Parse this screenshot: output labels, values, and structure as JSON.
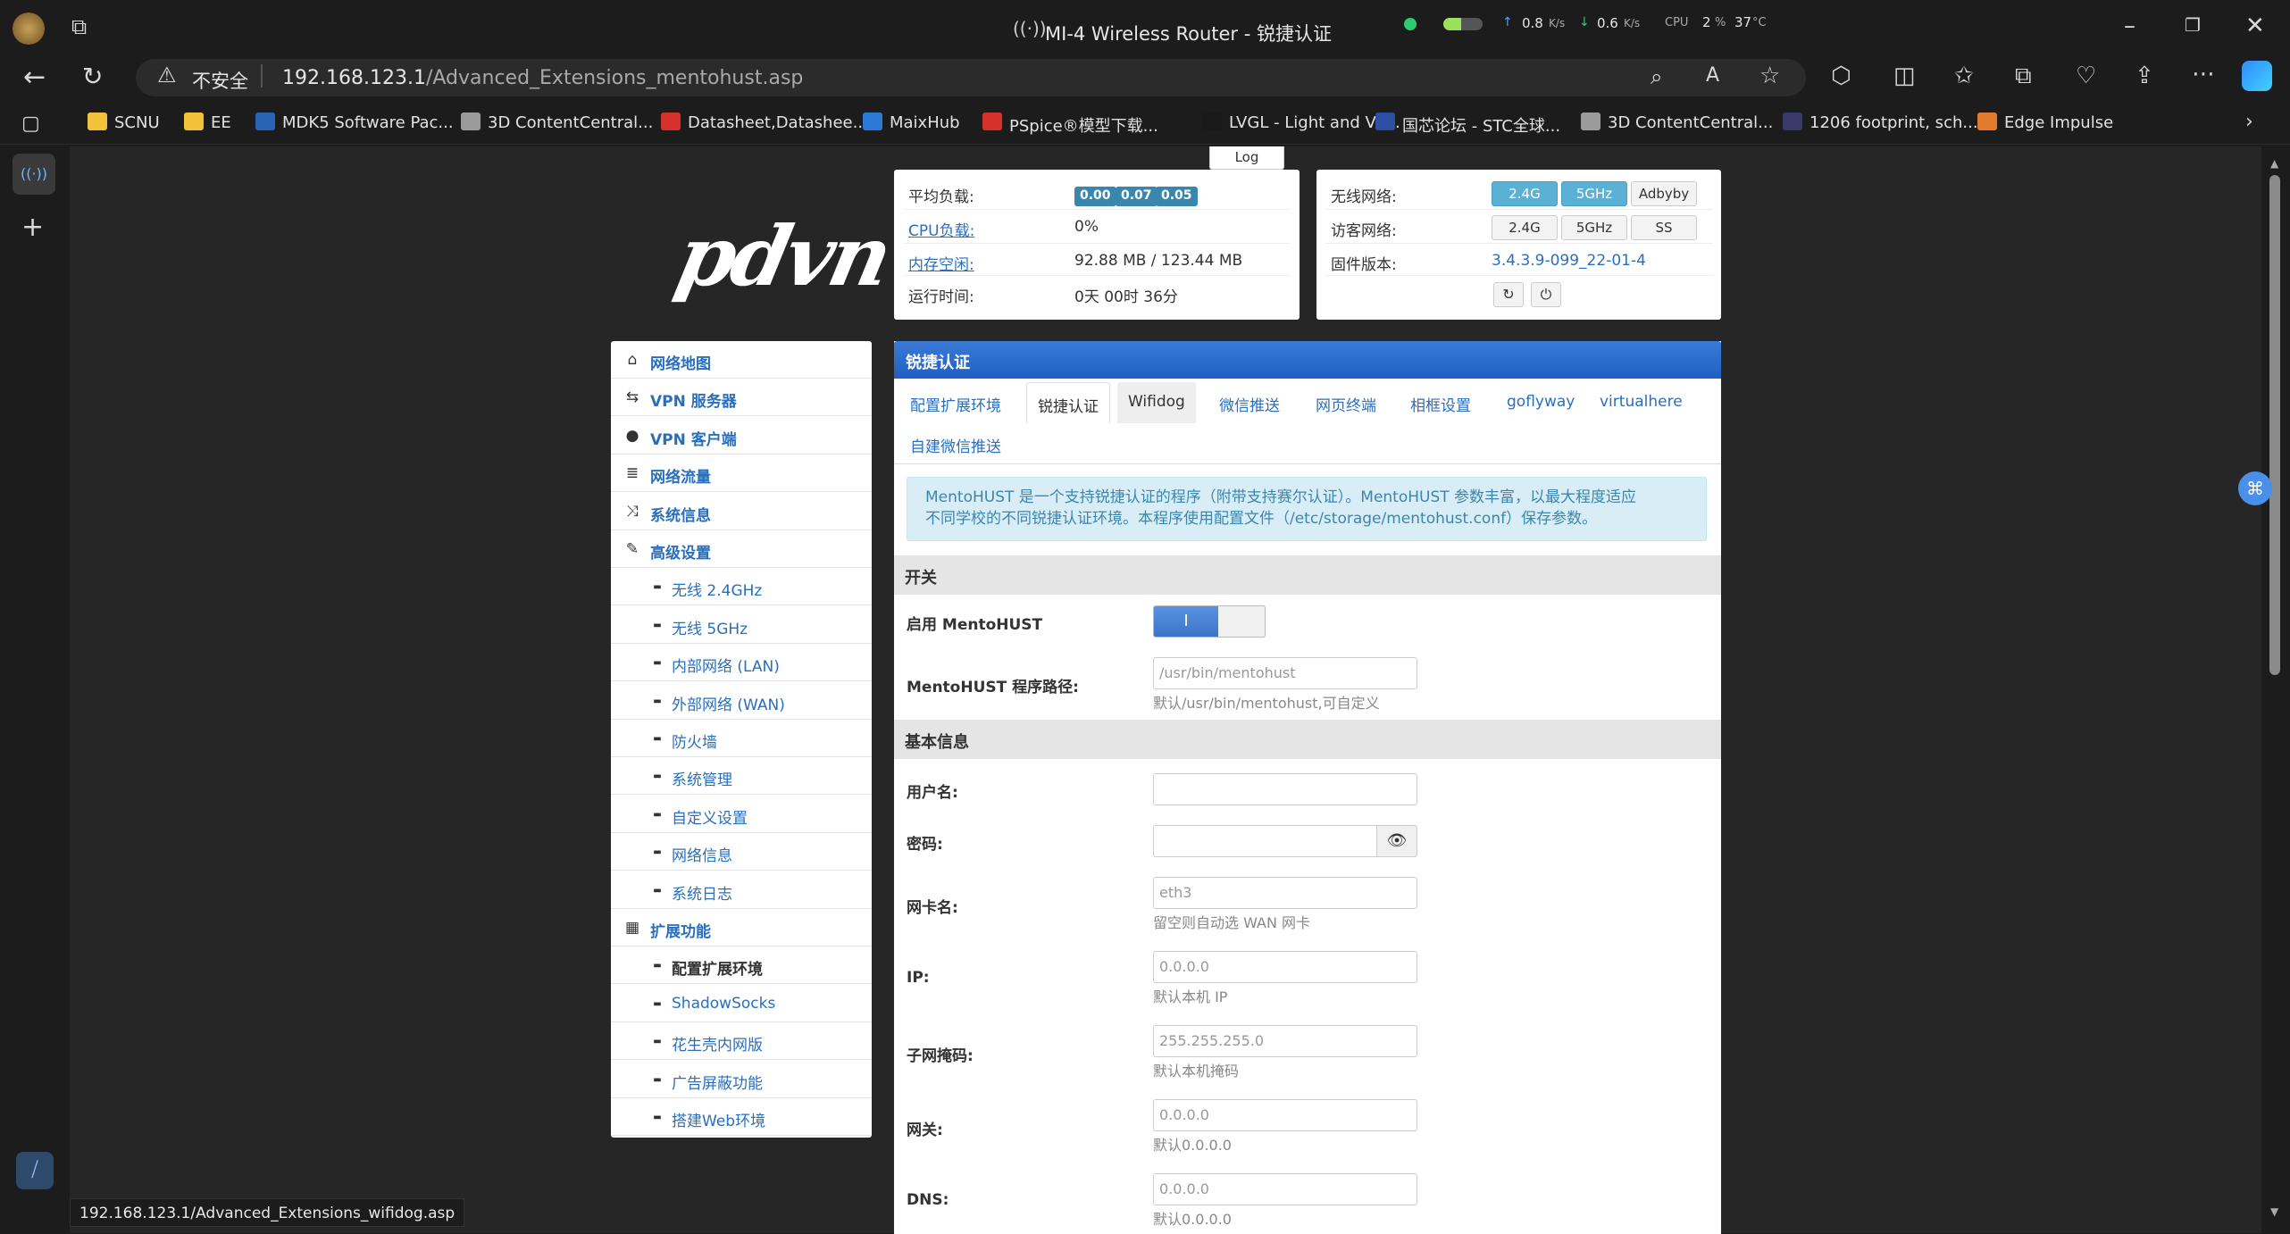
{
  "window": {
    "title": "MI-4 Wireless Router - 锐捷认证",
    "net_up": "0.8",
    "net_down": "0.6",
    "net_unit": "K/s",
    "cpu_label": "CPU",
    "cpu_value": "2",
    "cpu_unit": "%",
    "temp": "37",
    "temp_unit": "°C"
  },
  "address": {
    "insecure_label": "不安全",
    "url_host": "192.168.123.1",
    "url_path": "/Advanced_Extensions_mentohust.asp"
  },
  "favorites": [
    {
      "label": "SCNU",
      "color": "#f2c23a"
    },
    {
      "label": "EE",
      "color": "#f2c23a"
    },
    {
      "label": "MDK5 Software Pac...",
      "color": "#2a62b6"
    },
    {
      "label": "3D ContentCentral...",
      "color": "#9b9b9b"
    },
    {
      "label": "Datasheet,Datashee...",
      "color": "#d6322b"
    },
    {
      "label": "MaixHub",
      "color": "#2b7bd6"
    },
    {
      "label": "PSpice®模型下载...",
      "color": "#d6322b"
    },
    {
      "label": "LVGL - Light and Ve...",
      "color": "#1a1a1a"
    },
    {
      "label": "国芯论坛 - STC全球...",
      "color": "#2c4fa3"
    },
    {
      "label": "3D ContentCentral...",
      "color": "#9b9b9b"
    },
    {
      "label": "1206 footprint, sch...",
      "color": "#3a3a6a"
    },
    {
      "label": "Edge Impulse",
      "color": "#e07a2d"
    }
  ],
  "log_tab": "Log",
  "status_panel": {
    "load_label": "平均负载:",
    "load_values": [
      "0.00",
      "0.07",
      "0.05"
    ],
    "cpu_label": "CPU负载:",
    "cpu_value": "0%",
    "mem_label": "内存空闲:",
    "mem_value": "92.88 MB / 123.44 MB",
    "uptime_label": "运行时间:",
    "uptime_value": "0天 00时 36分"
  },
  "wifi_panel": {
    "wireless_label": "无线网络:",
    "wireless_btns": [
      "2.4G",
      "5GHz",
      "Adbyby"
    ],
    "guest_label": "访客网络:",
    "guest_btns": [
      "2.4G",
      "5GHz",
      "SS"
    ],
    "fw_label": "固件版本:",
    "fw_value": "3.4.3.9-099_22-01-4"
  },
  "menu": [
    {
      "label": "网络地图",
      "icon": "home-icon",
      "glyph": "⌂"
    },
    {
      "label": "VPN 服务器",
      "icon": "retweet-icon",
      "glyph": "⇆"
    },
    {
      "label": "VPN 客户端",
      "icon": "globe-icon",
      "glyph": "●"
    },
    {
      "label": "网络流量",
      "icon": "storage-icon",
      "glyph": "≣"
    },
    {
      "label": "系统信息",
      "icon": "random-icon",
      "glyph": "⤨"
    },
    {
      "label": "高级设置",
      "icon": "wrench-icon",
      "glyph": "✎"
    },
    {
      "label": "无线 2.4GHz",
      "sub": true
    },
    {
      "label": "无线 5GHz",
      "sub": true
    },
    {
      "label": "内部网络 (LAN)",
      "sub": true
    },
    {
      "label": "外部网络 (WAN)",
      "sub": true
    },
    {
      "label": "防火墙",
      "sub": true
    },
    {
      "label": "系统管理",
      "sub": true
    },
    {
      "label": "自定义设置",
      "sub": true
    },
    {
      "label": "网络信息",
      "sub": true
    },
    {
      "label": "系统日志",
      "sub": true
    },
    {
      "label": "扩展功能",
      "icon": "th-icon",
      "glyph": "▦"
    },
    {
      "label": "配置扩展环境",
      "sub": true,
      "current": true
    },
    {
      "label": "ShadowSocks",
      "sub": true
    },
    {
      "label": "花生壳内网版",
      "sub": true
    },
    {
      "label": "广告屏蔽功能",
      "sub": true
    },
    {
      "label": "搭建Web环境",
      "sub": true
    }
  ],
  "panel": {
    "title": "锐捷认证",
    "tabs": [
      "配置扩展环境",
      "锐捷认证",
      "Wifidog",
      "微信推送",
      "网页终端",
      "相框设置",
      "goflyway",
      "virtualhere",
      "自建微信推送"
    ],
    "alert_line1": "MentoHUST 是一个支持锐捷认证的程序（附带支持赛尔认证）。MentoHUST 参数丰富，以最大程度适应",
    "alert_line2": "不同学校的不同锐捷认证环境。本程序使用配置文件（/etc/storage/mentohust.conf）保存参数。",
    "section_switch": "开关",
    "enable_label": "启用 MentoHUST",
    "toggle_on": "I",
    "path_label": "MentoHUST 程序路径:",
    "path_placeholder": "/usr/bin/mentohust",
    "path_hint": "默认/usr/bin/mentohust,可自定义",
    "section_basic": "基本信息",
    "user_label": "用户名:",
    "user_value": "",
    "pass_label": "密码:",
    "pass_value": "",
    "nic_label": "网卡名:",
    "nic_placeholder": "eth3",
    "nic_hint": "留空则自动选 WAN 网卡",
    "ip_label": "IP:",
    "ip_placeholder": "0.0.0.0",
    "ip_hint": "默认本机 IP",
    "mask_label": "子网掩码:",
    "mask_placeholder": "255.255.255.0",
    "mask_hint": "默认本机掩码",
    "gw_label": "网关:",
    "gw_placeholder": "0.0.0.0",
    "gw_hint": "默认0.0.0.0",
    "dns_label": "DNS:",
    "dns_placeholder": "0.0.0.0",
    "dns_hint": "默认0.0.0.0"
  },
  "status_bar_url": "192.168.123.1/Advanced_Extensions_wifidog.asp"
}
